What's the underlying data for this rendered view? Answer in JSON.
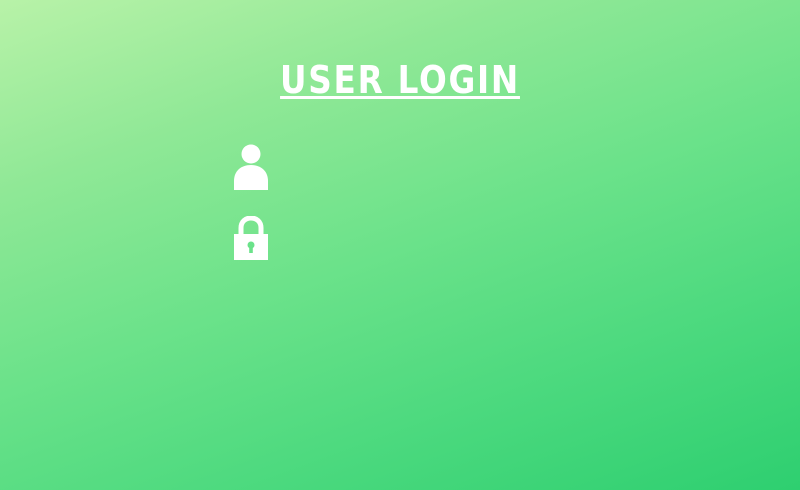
{
  "title": "USER LOGIN",
  "username": {
    "icon": "user-icon",
    "value": "",
    "placeholder": ""
  },
  "password": {
    "icon": "lock-icon",
    "value": "",
    "placeholder": ""
  },
  "colors": {
    "background_start": "#b8f2a8",
    "background_end": "#2ecf70",
    "foreground": "#ffffff"
  }
}
